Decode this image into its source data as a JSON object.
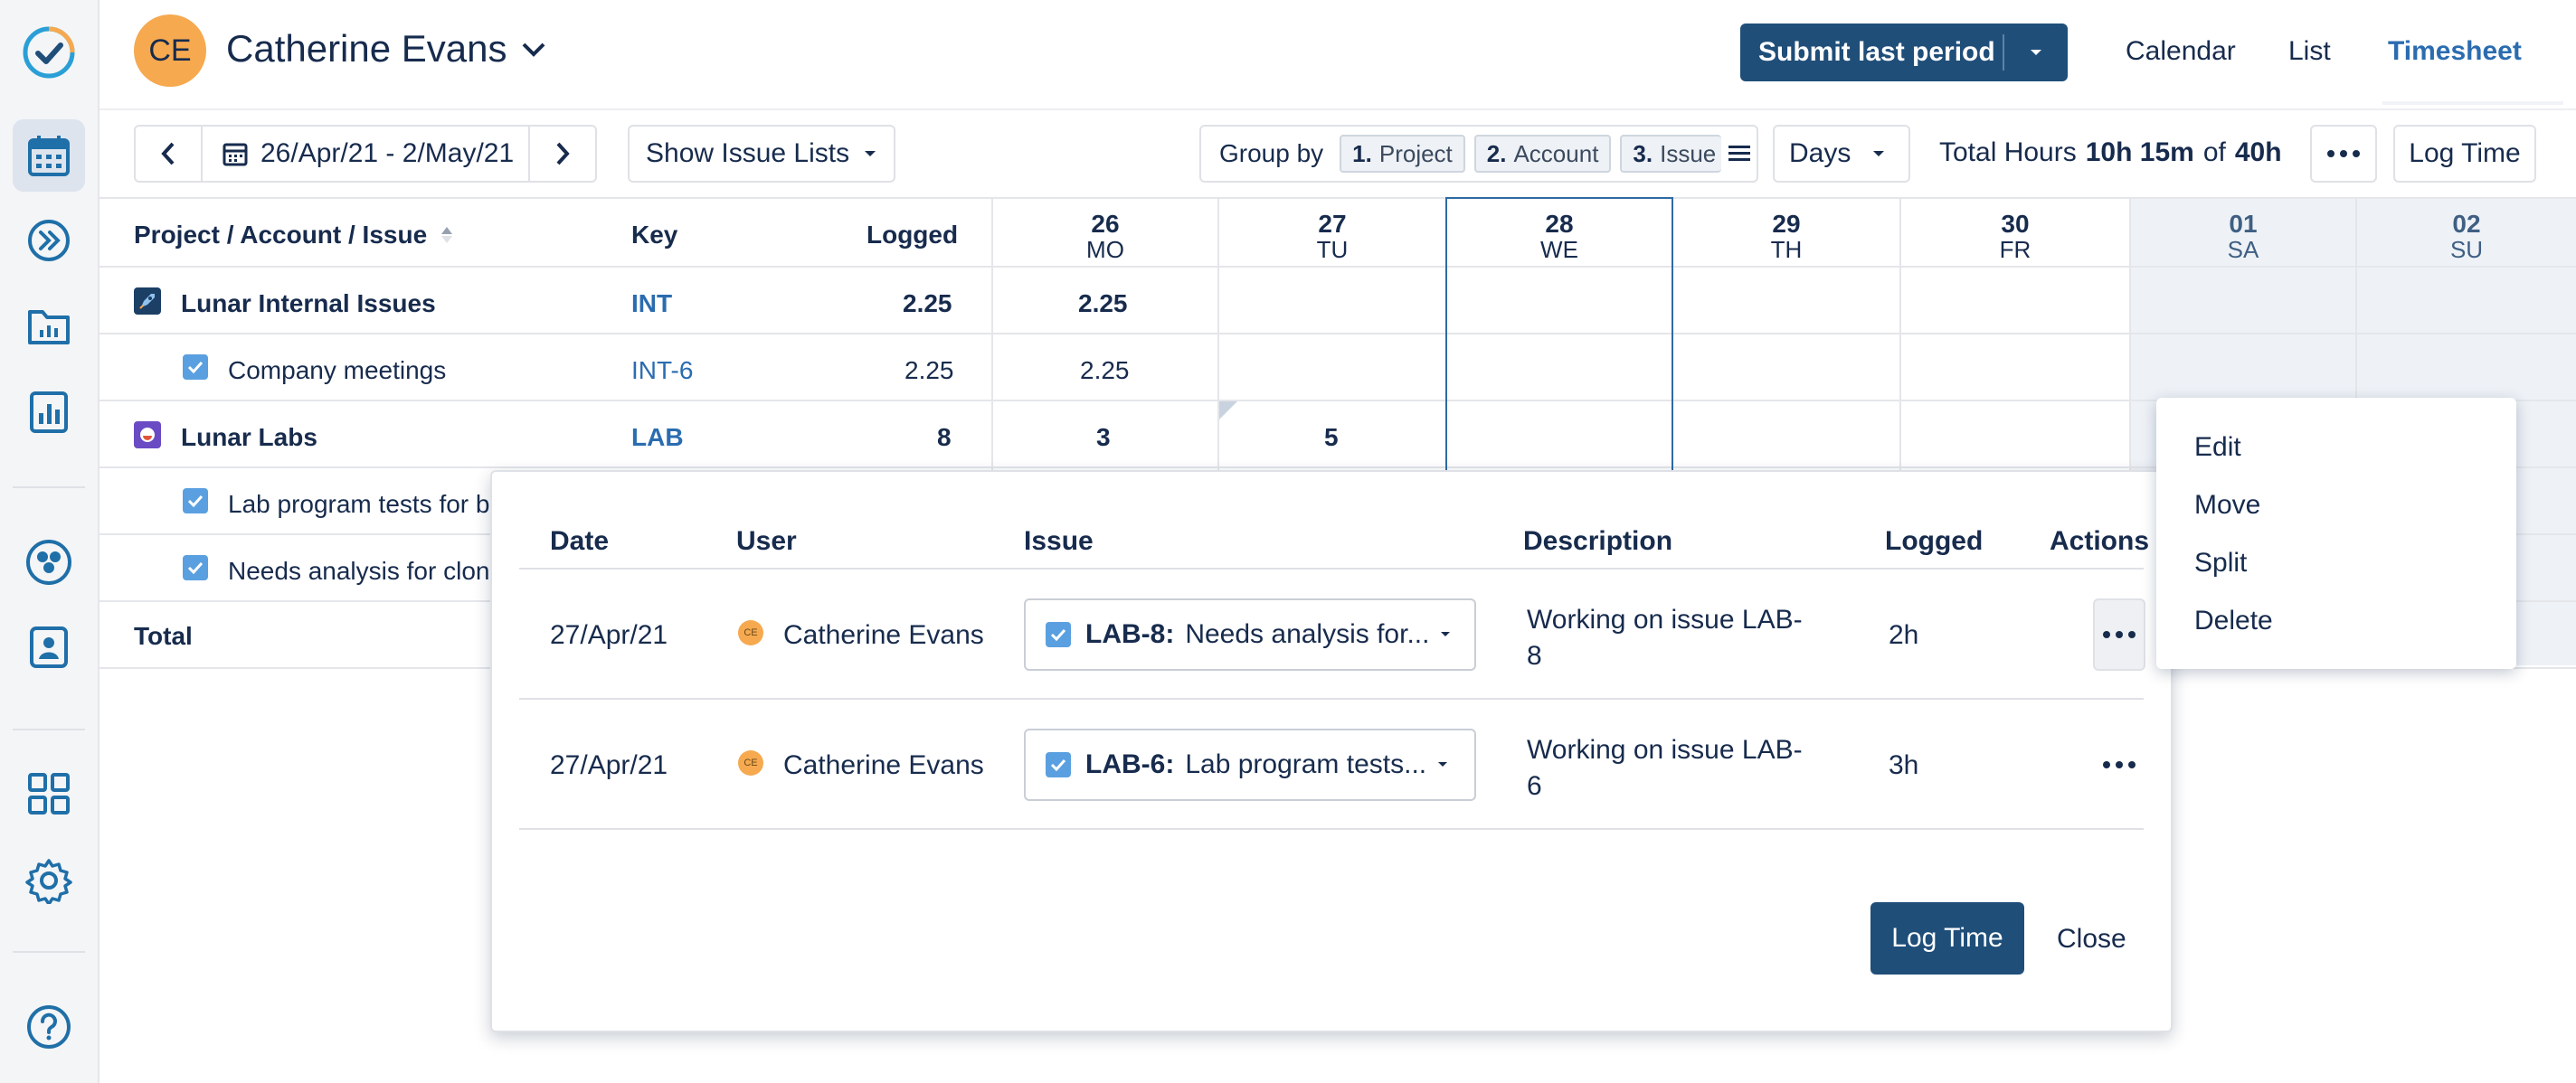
{
  "header": {
    "avatar_initials": "CE",
    "user_name": "Catherine Evans",
    "submit_label": "Submit last period",
    "tabs": [
      "Calendar",
      "List",
      "Timesheet"
    ],
    "active_tab": "Timesheet"
  },
  "toolbar": {
    "date_range": "26/Apr/21 - 2/May/21",
    "show_issue_lists": "Show Issue Lists",
    "group_by_label": "Group by",
    "group_chips": [
      {
        "num": "1.",
        "label": "Project"
      },
      {
        "num": "2.",
        "label": "Account"
      },
      {
        "num": "3.",
        "label": "Issue"
      }
    ],
    "period": "Days",
    "total_hours_label": "Total Hours",
    "total_hours_logged": "10h 15m",
    "total_hours_of": "of",
    "total_hours_target": "40h",
    "log_time": "Log Time"
  },
  "grid": {
    "headers": {
      "project": "Project / Account / Issue",
      "key": "Key",
      "logged": "Logged"
    },
    "days": [
      {
        "num": "26",
        "wd": "MO"
      },
      {
        "num": "27",
        "wd": "TU"
      },
      {
        "num": "28",
        "wd": "WE"
      },
      {
        "num": "29",
        "wd": "TH"
      },
      {
        "num": "30",
        "wd": "FR"
      },
      {
        "num": "01",
        "wd": "SA"
      },
      {
        "num": "02",
        "wd": "SU"
      }
    ],
    "rows": [
      {
        "name": "Lunar Internal Issues",
        "key": "INT",
        "logged": "2.25",
        "d26": "2.25",
        "d27": ""
      },
      {
        "name": "Company meetings",
        "key": "INT-6",
        "logged": "2.25",
        "d26": "2.25",
        "d27": ""
      },
      {
        "name": "Lunar Labs",
        "key": "LAB",
        "logged": "8",
        "d26": "3",
        "d27": "5"
      },
      {
        "name": "Lab program tests for bi"
      },
      {
        "name": "Needs analysis for clone"
      }
    ],
    "total_label": "Total"
  },
  "popup": {
    "headers": {
      "date": "Date",
      "user": "User",
      "issue": "Issue",
      "description": "Description",
      "logged": "Logged",
      "actions": "Actions"
    },
    "worklogs": [
      {
        "date": "27/Apr/21",
        "avatar": "CE",
        "user": "Catherine Evans",
        "issue_key": "LAB-8:",
        "issue_title": "Needs analysis for...",
        "description_1": "Working on issue LAB-",
        "description_2": "8",
        "logged": "2h"
      },
      {
        "date": "27/Apr/21",
        "avatar": "CE",
        "user": "Catherine Evans",
        "issue_key": "LAB-6:",
        "issue_title": "Lab program tests...",
        "description_1": "Working on issue LAB-",
        "description_2": "6",
        "logged": "3h"
      }
    ],
    "log_time": "Log Time",
    "close": "Close"
  },
  "context_menu": {
    "items": [
      "Edit",
      "Move",
      "Split",
      "Delete"
    ]
  },
  "colors": {
    "primary": "#1f4e79",
    "link": "#2b6cb0",
    "avatar": "#f6a94f",
    "checkbox": "#5aa0e0"
  }
}
